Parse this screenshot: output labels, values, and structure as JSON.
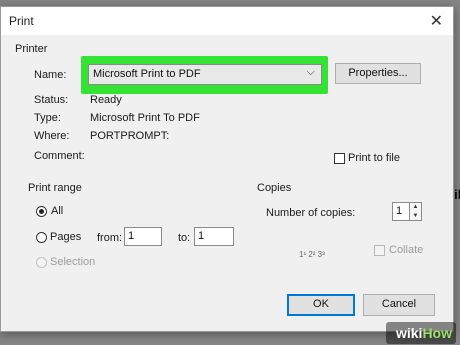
{
  "window": {
    "title": "Print"
  },
  "printer": {
    "section_label": "Printer",
    "name_label": "Name:",
    "selected": "Microsoft Print to PDF",
    "properties_label": "Properties...",
    "status_label": "Status:",
    "status_value": "Ready",
    "type_label": "Type:",
    "type_value": "Microsoft Print To PDF",
    "where_label": "Where:",
    "where_value": "PORTPROMPT:",
    "comment_label": "Comment:",
    "print_to_file_label": "Print to file"
  },
  "print_range": {
    "section_label": "Print range",
    "all_label": "All",
    "pages_label": "Pages",
    "from_label": "from:",
    "from_value": "1",
    "to_label": "to:",
    "to_value": "1",
    "selection_label": "Selection"
  },
  "copies": {
    "section_label": "Copies",
    "number_label": "Number of copies:",
    "number_value": "1",
    "collate_label": "Collate",
    "collate_icon_text": "1¹ 2² 3³"
  },
  "buttons": {
    "ok": "OK",
    "cancel": "Cancel"
  },
  "background_text": {
    "left_a": "t",
    "left_b": "h",
    "right": "wil"
  },
  "watermark": {
    "part1": "wiki",
    "part2": "How"
  },
  "colors": {
    "highlight": "#34e334",
    "accent": "#0078d7"
  }
}
